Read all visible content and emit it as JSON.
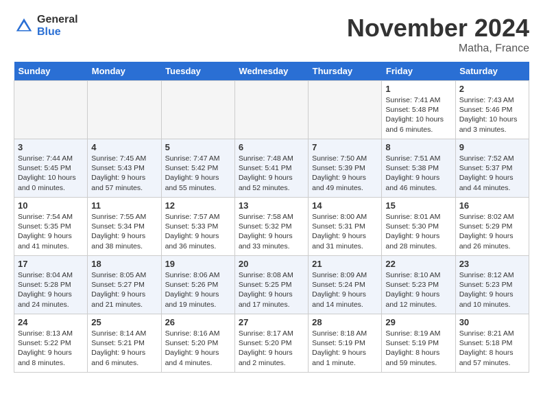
{
  "header": {
    "logo_general": "General",
    "logo_blue": "Blue",
    "month_title": "November 2024",
    "location": "Matha, France"
  },
  "weekdays": [
    "Sunday",
    "Monday",
    "Tuesday",
    "Wednesday",
    "Thursday",
    "Friday",
    "Saturday"
  ],
  "weeks": [
    [
      {
        "day": "",
        "info": ""
      },
      {
        "day": "",
        "info": ""
      },
      {
        "day": "",
        "info": ""
      },
      {
        "day": "",
        "info": ""
      },
      {
        "day": "",
        "info": ""
      },
      {
        "day": "1",
        "info": "Sunrise: 7:41 AM\nSunset: 5:48 PM\nDaylight: 10 hours\nand 6 minutes."
      },
      {
        "day": "2",
        "info": "Sunrise: 7:43 AM\nSunset: 5:46 PM\nDaylight: 10 hours\nand 3 minutes."
      }
    ],
    [
      {
        "day": "3",
        "info": "Sunrise: 7:44 AM\nSunset: 5:45 PM\nDaylight: 10 hours\nand 0 minutes."
      },
      {
        "day": "4",
        "info": "Sunrise: 7:45 AM\nSunset: 5:43 PM\nDaylight: 9 hours\nand 57 minutes."
      },
      {
        "day": "5",
        "info": "Sunrise: 7:47 AM\nSunset: 5:42 PM\nDaylight: 9 hours\nand 55 minutes."
      },
      {
        "day": "6",
        "info": "Sunrise: 7:48 AM\nSunset: 5:41 PM\nDaylight: 9 hours\nand 52 minutes."
      },
      {
        "day": "7",
        "info": "Sunrise: 7:50 AM\nSunset: 5:39 PM\nDaylight: 9 hours\nand 49 minutes."
      },
      {
        "day": "8",
        "info": "Sunrise: 7:51 AM\nSunset: 5:38 PM\nDaylight: 9 hours\nand 46 minutes."
      },
      {
        "day": "9",
        "info": "Sunrise: 7:52 AM\nSunset: 5:37 PM\nDaylight: 9 hours\nand 44 minutes."
      }
    ],
    [
      {
        "day": "10",
        "info": "Sunrise: 7:54 AM\nSunset: 5:35 PM\nDaylight: 9 hours\nand 41 minutes."
      },
      {
        "day": "11",
        "info": "Sunrise: 7:55 AM\nSunset: 5:34 PM\nDaylight: 9 hours\nand 38 minutes."
      },
      {
        "day": "12",
        "info": "Sunrise: 7:57 AM\nSunset: 5:33 PM\nDaylight: 9 hours\nand 36 minutes."
      },
      {
        "day": "13",
        "info": "Sunrise: 7:58 AM\nSunset: 5:32 PM\nDaylight: 9 hours\nand 33 minutes."
      },
      {
        "day": "14",
        "info": "Sunrise: 8:00 AM\nSunset: 5:31 PM\nDaylight: 9 hours\nand 31 minutes."
      },
      {
        "day": "15",
        "info": "Sunrise: 8:01 AM\nSunset: 5:30 PM\nDaylight: 9 hours\nand 28 minutes."
      },
      {
        "day": "16",
        "info": "Sunrise: 8:02 AM\nSunset: 5:29 PM\nDaylight: 9 hours\nand 26 minutes."
      }
    ],
    [
      {
        "day": "17",
        "info": "Sunrise: 8:04 AM\nSunset: 5:28 PM\nDaylight: 9 hours\nand 24 minutes."
      },
      {
        "day": "18",
        "info": "Sunrise: 8:05 AM\nSunset: 5:27 PM\nDaylight: 9 hours\nand 21 minutes."
      },
      {
        "day": "19",
        "info": "Sunrise: 8:06 AM\nSunset: 5:26 PM\nDaylight: 9 hours\nand 19 minutes."
      },
      {
        "day": "20",
        "info": "Sunrise: 8:08 AM\nSunset: 5:25 PM\nDaylight: 9 hours\nand 17 minutes."
      },
      {
        "day": "21",
        "info": "Sunrise: 8:09 AM\nSunset: 5:24 PM\nDaylight: 9 hours\nand 14 minutes."
      },
      {
        "day": "22",
        "info": "Sunrise: 8:10 AM\nSunset: 5:23 PM\nDaylight: 9 hours\nand 12 minutes."
      },
      {
        "day": "23",
        "info": "Sunrise: 8:12 AM\nSunset: 5:23 PM\nDaylight: 9 hours\nand 10 minutes."
      }
    ],
    [
      {
        "day": "24",
        "info": "Sunrise: 8:13 AM\nSunset: 5:22 PM\nDaylight: 9 hours\nand 8 minutes."
      },
      {
        "day": "25",
        "info": "Sunrise: 8:14 AM\nSunset: 5:21 PM\nDaylight: 9 hours\nand 6 minutes."
      },
      {
        "day": "26",
        "info": "Sunrise: 8:16 AM\nSunset: 5:20 PM\nDaylight: 9 hours\nand 4 minutes."
      },
      {
        "day": "27",
        "info": "Sunrise: 8:17 AM\nSunset: 5:20 PM\nDaylight: 9 hours\nand 2 minutes."
      },
      {
        "day": "28",
        "info": "Sunrise: 8:18 AM\nSunset: 5:19 PM\nDaylight: 9 hours\nand 1 minute."
      },
      {
        "day": "29",
        "info": "Sunrise: 8:19 AM\nSunset: 5:19 PM\nDaylight: 8 hours\nand 59 minutes."
      },
      {
        "day": "30",
        "info": "Sunrise: 8:21 AM\nSunset: 5:18 PM\nDaylight: 8 hours\nand 57 minutes."
      }
    ]
  ]
}
